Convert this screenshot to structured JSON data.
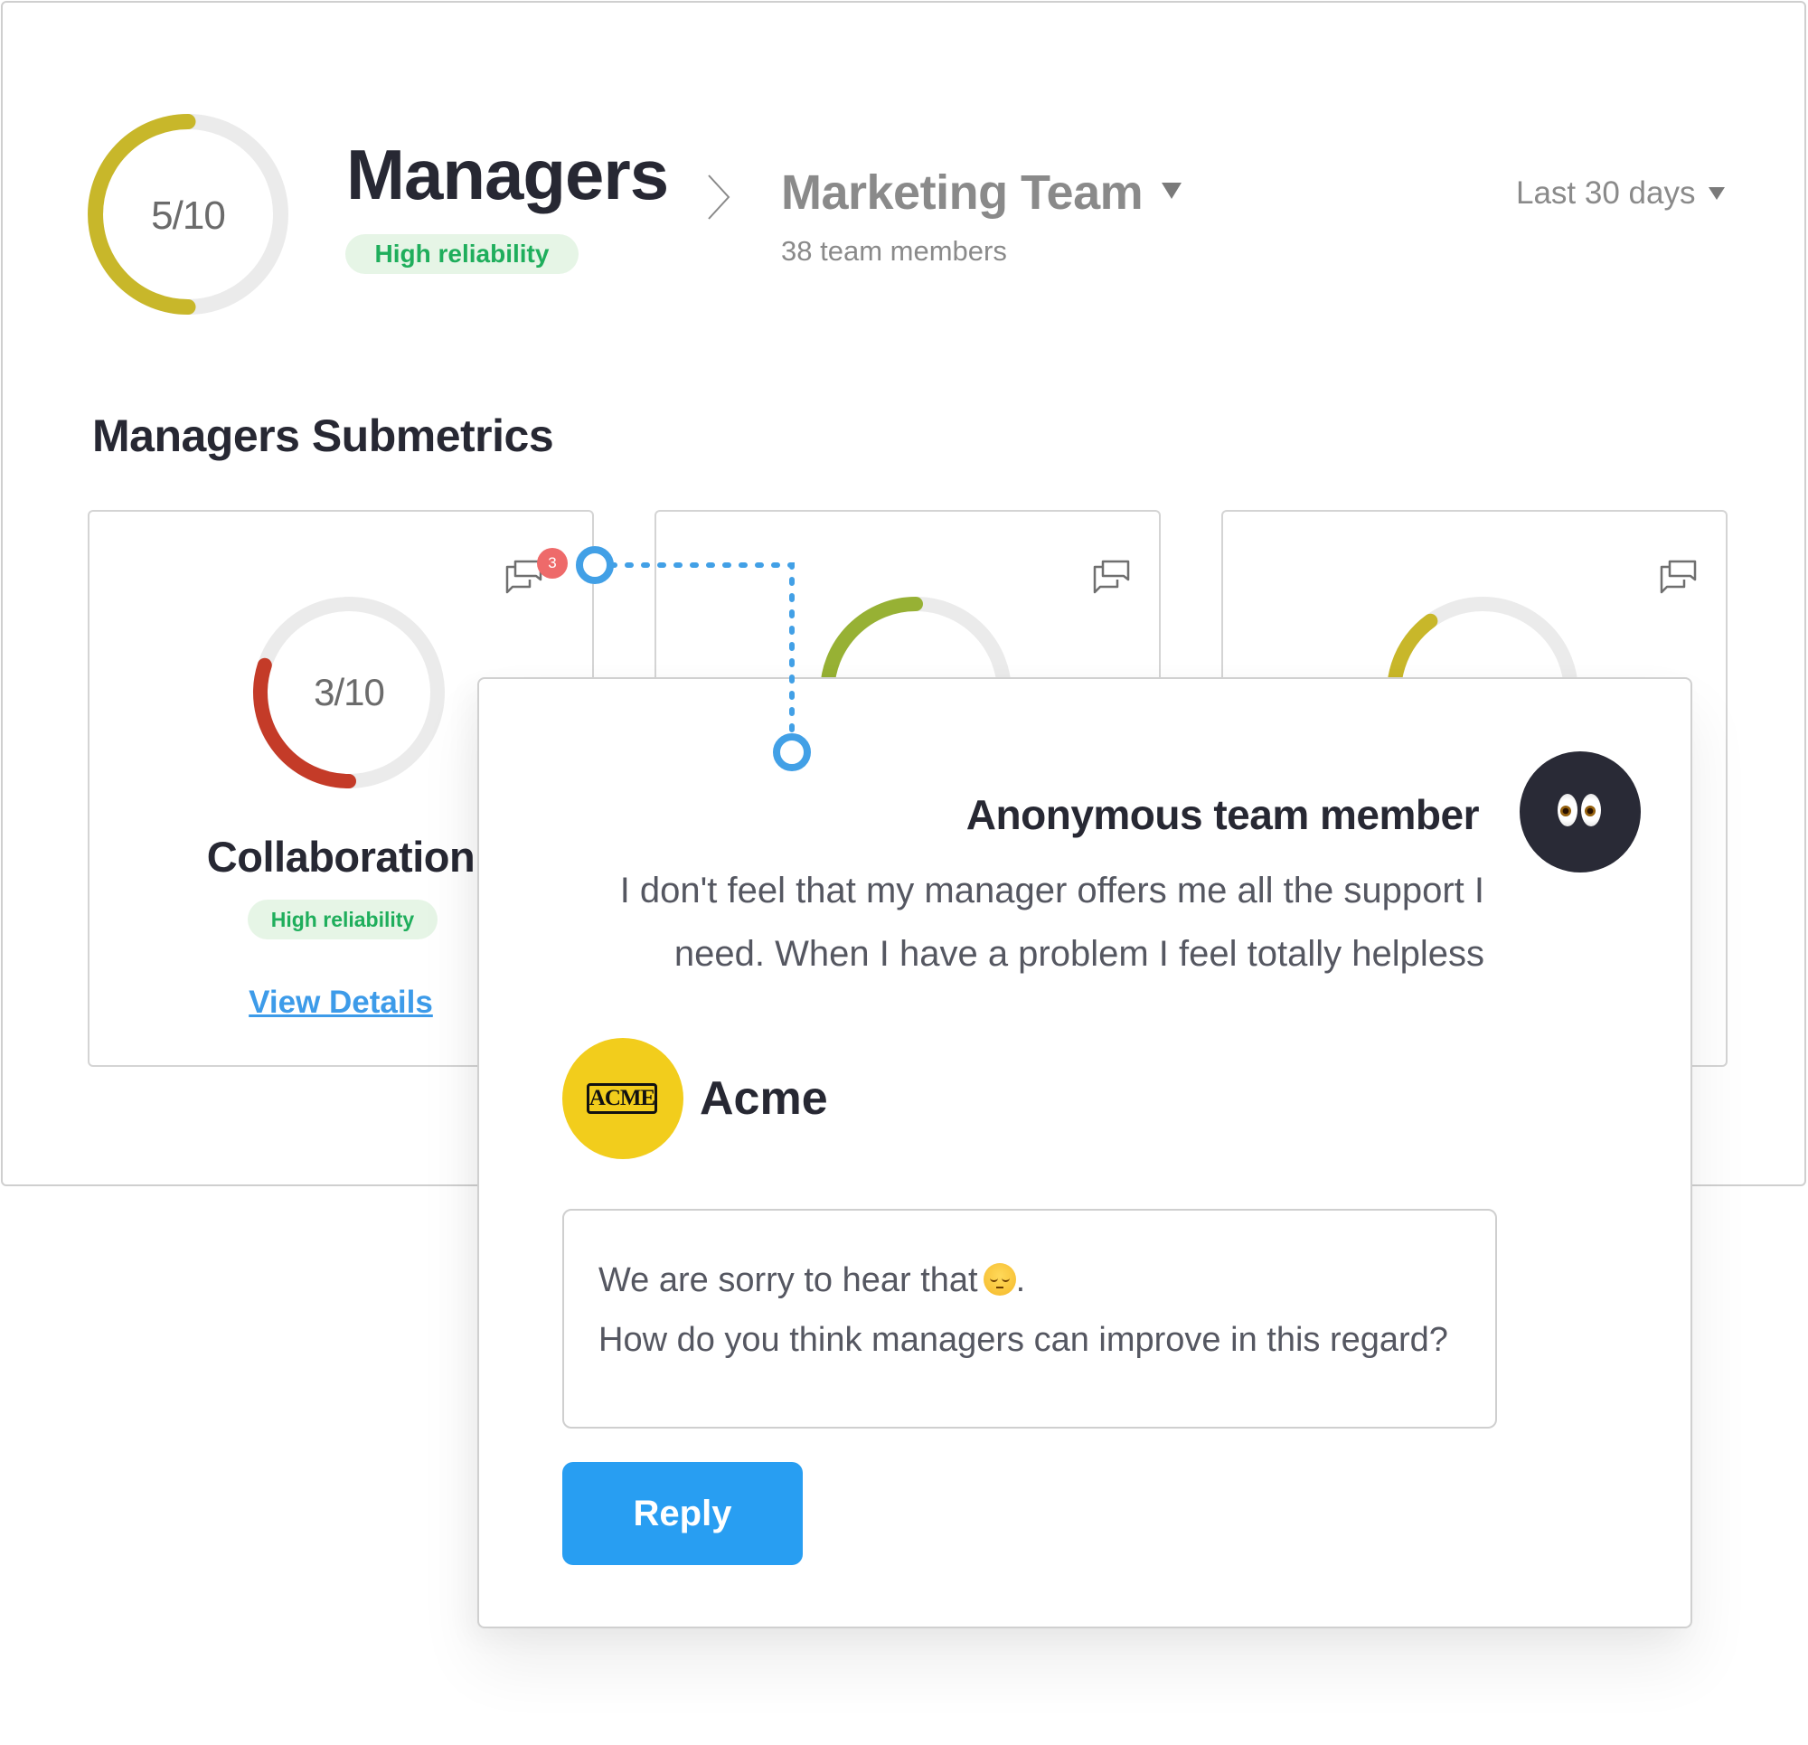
{
  "header": {
    "score": {
      "value": 5,
      "max": 10,
      "label": "5/10",
      "color": "#c8b72a"
    },
    "title": "Managers",
    "reliability_badge": "High reliability",
    "breadcrumb_separator_icon": "chevron-right-icon",
    "team": {
      "name": "Marketing Team",
      "members": "38 team members",
      "dropdown_icon": "caret-down-icon"
    },
    "period": {
      "label": "Last 30 days",
      "dropdown_icon": "caret-down-icon"
    }
  },
  "section_title": "Managers Submetrics",
  "cards": [
    {
      "name": "Collaboration",
      "score": {
        "value": 3,
        "max": 10,
        "label": "3/10",
        "color": "#c43b28"
      },
      "reliability_badge": "High reliability",
      "link": "View Details",
      "comment_count": "3",
      "comment_icon": "comments-icon"
    },
    {
      "score": {
        "value": 5,
        "max": 10,
        "color": "#97b134"
      },
      "comment_icon": "comments-icon"
    },
    {
      "score": {
        "value": 4,
        "max": 10,
        "color": "#c8b72a"
      },
      "comment_icon": "comments-icon"
    }
  ],
  "popover": {
    "author": "Anonymous team member",
    "author_avatar": "eyes-emoji",
    "message": "I don't feel that my manager offers me all the support I need. When I have a problem I feel totally helpless",
    "responder": "Acme",
    "responder_logo": "ACME",
    "reply_lines": [
      "We are sorry to hear that",
      ".",
      "How do you think managers can improve in this regard?"
    ],
    "reply_emoji": "pensive-face-emoji",
    "reply_button": "Reply"
  },
  "colors": {
    "accent_blue": "#289ef2",
    "connector_blue": "#42a0e6",
    "badge_green_bg": "#e6f5e6",
    "badge_green_text": "#1fae5c",
    "notification_red": "#ee6a6a",
    "ring_track": "#ebebeb"
  }
}
